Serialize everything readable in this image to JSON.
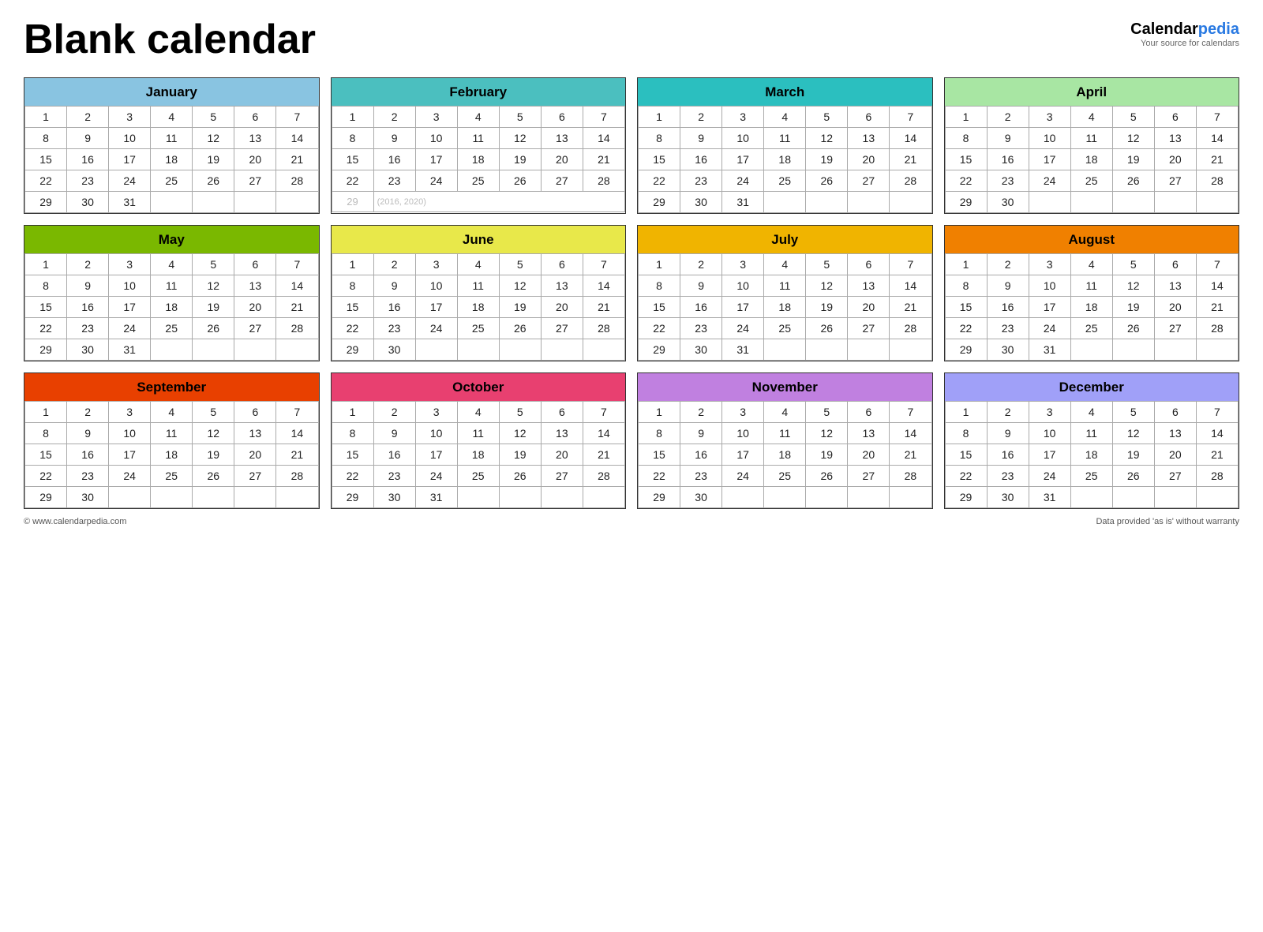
{
  "title": "Blank calendar",
  "brand": {
    "calendar": "Calendar",
    "pedia": "pedia",
    "tagline": "Your source for calendars"
  },
  "footer": {
    "left": "© www.calendarpedia.com",
    "right": "Data provided 'as is' without warranty"
  },
  "months": [
    {
      "name": "January",
      "color": "#89c4e1",
      "weeks": [
        [
          1,
          2,
          3,
          4,
          5,
          6,
          7
        ],
        [
          8,
          9,
          10,
          11,
          12,
          13,
          14
        ],
        [
          15,
          16,
          17,
          18,
          19,
          20,
          21
        ],
        [
          22,
          23,
          24,
          25,
          26,
          27,
          28
        ],
        [
          29,
          30,
          31,
          0,
          0,
          0,
          0
        ]
      ]
    },
    {
      "name": "February",
      "color": "#4bbfbf",
      "weeks": [
        [
          1,
          2,
          3,
          4,
          5,
          6,
          7
        ],
        [
          8,
          9,
          10,
          11,
          12,
          13,
          14
        ],
        [
          15,
          16,
          17,
          18,
          19,
          20,
          21
        ],
        [
          22,
          23,
          24,
          25,
          26,
          27,
          28
        ],
        [
          "29*",
          0,
          0,
          0,
          0,
          0,
          0
        ]
      ],
      "feb29note": "(2016, 2020)"
    },
    {
      "name": "March",
      "color": "#2bbfbf",
      "weeks": [
        [
          1,
          2,
          3,
          4,
          5,
          6,
          7
        ],
        [
          8,
          9,
          10,
          11,
          12,
          13,
          14
        ],
        [
          15,
          16,
          17,
          18,
          19,
          20,
          21
        ],
        [
          22,
          23,
          24,
          25,
          26,
          27,
          28
        ],
        [
          29,
          30,
          31,
          0,
          0,
          0,
          0
        ]
      ]
    },
    {
      "name": "April",
      "color": "#a8e6a3",
      "weeks": [
        [
          1,
          2,
          3,
          4,
          5,
          6,
          7
        ],
        [
          8,
          9,
          10,
          11,
          12,
          13,
          14
        ],
        [
          15,
          16,
          17,
          18,
          19,
          20,
          21
        ],
        [
          22,
          23,
          24,
          25,
          26,
          27,
          28
        ],
        [
          29,
          30,
          0,
          0,
          0,
          0,
          0
        ]
      ]
    },
    {
      "name": "May",
      "color": "#7ab800",
      "weeks": [
        [
          1,
          2,
          3,
          4,
          5,
          6,
          7
        ],
        [
          8,
          9,
          10,
          11,
          12,
          13,
          14
        ],
        [
          15,
          16,
          17,
          18,
          19,
          20,
          21
        ],
        [
          22,
          23,
          24,
          25,
          26,
          27,
          28
        ],
        [
          29,
          30,
          31,
          0,
          0,
          0,
          0
        ]
      ]
    },
    {
      "name": "June",
      "color": "#e8e84a",
      "weeks": [
        [
          1,
          2,
          3,
          4,
          5,
          6,
          7
        ],
        [
          8,
          9,
          10,
          11,
          12,
          13,
          14
        ],
        [
          15,
          16,
          17,
          18,
          19,
          20,
          21
        ],
        [
          22,
          23,
          24,
          25,
          26,
          27,
          28
        ],
        [
          29,
          30,
          0,
          0,
          0,
          0,
          0
        ]
      ]
    },
    {
      "name": "July",
      "color": "#f0b400",
      "weeks": [
        [
          1,
          2,
          3,
          4,
          5,
          6,
          7
        ],
        [
          8,
          9,
          10,
          11,
          12,
          13,
          14
        ],
        [
          15,
          16,
          17,
          18,
          19,
          20,
          21
        ],
        [
          22,
          23,
          24,
          25,
          26,
          27,
          28
        ],
        [
          29,
          30,
          31,
          0,
          0,
          0,
          0
        ]
      ]
    },
    {
      "name": "August",
      "color": "#f08000",
      "weeks": [
        [
          1,
          2,
          3,
          4,
          5,
          6,
          7
        ],
        [
          8,
          9,
          10,
          11,
          12,
          13,
          14
        ],
        [
          15,
          16,
          17,
          18,
          19,
          20,
          21
        ],
        [
          22,
          23,
          24,
          25,
          26,
          27,
          28
        ],
        [
          29,
          30,
          31,
          0,
          0,
          0,
          0
        ]
      ]
    },
    {
      "name": "September",
      "color": "#e84000",
      "weeks": [
        [
          1,
          2,
          3,
          4,
          5,
          6,
          7
        ],
        [
          8,
          9,
          10,
          11,
          12,
          13,
          14
        ],
        [
          15,
          16,
          17,
          18,
          19,
          20,
          21
        ],
        [
          22,
          23,
          24,
          25,
          26,
          27,
          28
        ],
        [
          29,
          30,
          0,
          0,
          0,
          0,
          0
        ]
      ]
    },
    {
      "name": "October",
      "color": "#e84070",
      "weeks": [
        [
          1,
          2,
          3,
          4,
          5,
          6,
          7
        ],
        [
          8,
          9,
          10,
          11,
          12,
          13,
          14
        ],
        [
          15,
          16,
          17,
          18,
          19,
          20,
          21
        ],
        [
          22,
          23,
          24,
          25,
          26,
          27,
          28
        ],
        [
          29,
          30,
          31,
          0,
          0,
          0,
          0
        ]
      ]
    },
    {
      "name": "November",
      "color": "#c080e0",
      "weeks": [
        [
          1,
          2,
          3,
          4,
          5,
          6,
          7
        ],
        [
          8,
          9,
          10,
          11,
          12,
          13,
          14
        ],
        [
          15,
          16,
          17,
          18,
          19,
          20,
          21
        ],
        [
          22,
          23,
          24,
          25,
          26,
          27,
          28
        ],
        [
          29,
          30,
          0,
          0,
          0,
          0,
          0
        ]
      ]
    },
    {
      "name": "December",
      "color": "#a0a0f8",
      "weeks": [
        [
          1,
          2,
          3,
          4,
          5,
          6,
          7
        ],
        [
          8,
          9,
          10,
          11,
          12,
          13,
          14
        ],
        [
          15,
          16,
          17,
          18,
          19,
          20,
          21
        ],
        [
          22,
          23,
          24,
          25,
          26,
          27,
          28
        ],
        [
          29,
          30,
          31,
          0,
          0,
          0,
          0
        ]
      ]
    }
  ]
}
